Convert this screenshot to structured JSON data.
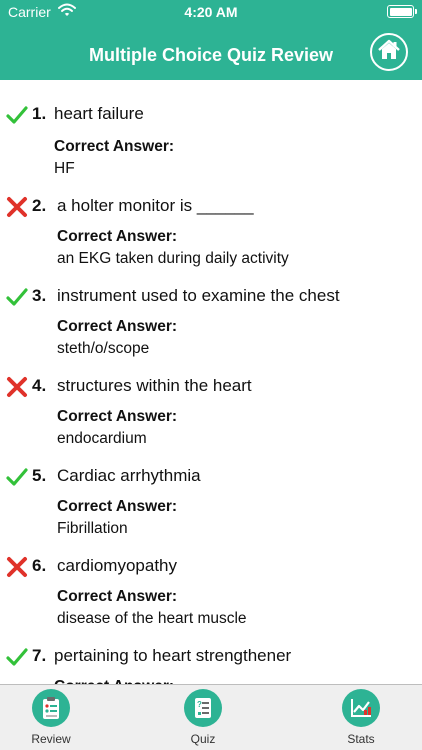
{
  "status_bar": {
    "carrier": "Carrier",
    "time": "4:20 AM"
  },
  "header": {
    "title": "Multiple Choice Quiz Review",
    "home_icon": "home-icon"
  },
  "colors": {
    "accent": "#2db394",
    "correct": "#33c13a",
    "wrong": "#e0322a"
  },
  "review": {
    "correct_answer_label": "Correct Answer:",
    "items": [
      {
        "number": "1.",
        "question": "heart failure",
        "answer": "HF",
        "result": "correct"
      },
      {
        "number": "2.",
        "question": "a holter monitor is ______",
        "answer": "an EKG taken during daily activity",
        "result": "wrong"
      },
      {
        "number": "3.",
        "question": "instrument used to examine the chest",
        "answer": "steth/o/scope",
        "result": "correct"
      },
      {
        "number": "4.",
        "question": "structures within the heart",
        "answer": "endocardium",
        "result": "wrong"
      },
      {
        "number": "5.",
        "question": "Cardiac arrhythmia",
        "answer": "Fibrillation",
        "result": "correct"
      },
      {
        "number": "6.",
        "question": "cardiomyopathy",
        "answer": "disease of the heart muscle",
        "result": "wrong"
      },
      {
        "number": "7.",
        "question": "pertaining to heart strengthener",
        "answer": "",
        "result": "correct"
      }
    ]
  },
  "tabs": [
    {
      "label": "Review",
      "icon": "clipboard-icon"
    },
    {
      "label": "Quiz",
      "icon": "checklist-icon"
    },
    {
      "label": "Stats",
      "icon": "chart-icon"
    }
  ]
}
